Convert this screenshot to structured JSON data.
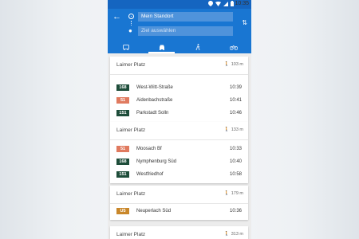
{
  "status_bar": {
    "time": "10:35"
  },
  "search": {
    "from_value": "Mein Standort",
    "to_placeholder": "Ziel auswählen"
  },
  "modes": [
    "public-transport",
    "car",
    "walk",
    "bike"
  ],
  "colors": {
    "bus": "#1e4d3a",
    "sbahn": "#e07a5f",
    "express": "#c9872a",
    "appbar": "#1976d2"
  },
  "cards": [
    {
      "stop": "Laimer Platz",
      "distance": "103 m",
      "departures": [
        {
          "line": "168",
          "destination": "West-Witt-Straße",
          "time": "10:39",
          "type": "bus"
        },
        {
          "line": "51",
          "destination": "Aidenbachstraße",
          "time": "10:41",
          "type": "sbahn"
        },
        {
          "line": "151",
          "destination": "Parkstadt Solln",
          "time": "10:46",
          "type": "bus"
        }
      ]
    },
    {
      "stop": "Laimer Platz",
      "distance": "133 m",
      "departures": [
        {
          "line": "51",
          "destination": "Moosach Bf",
          "time": "10:33",
          "type": "sbahn"
        },
        {
          "line": "168",
          "destination": "Nymphenburg Süd",
          "time": "10:40",
          "type": "bus"
        },
        {
          "line": "151",
          "destination": "Westfriedhof",
          "time": "10:58",
          "type": "bus"
        }
      ]
    },
    {
      "stop": "Laimer Platz",
      "distance": "179 m",
      "departures": [
        {
          "line": "U5",
          "destination": "Neuperlach Süd",
          "time": "10:36",
          "type": "express"
        }
      ]
    },
    {
      "stop": "Laimer Platz",
      "distance": "313 m",
      "departures": []
    }
  ]
}
